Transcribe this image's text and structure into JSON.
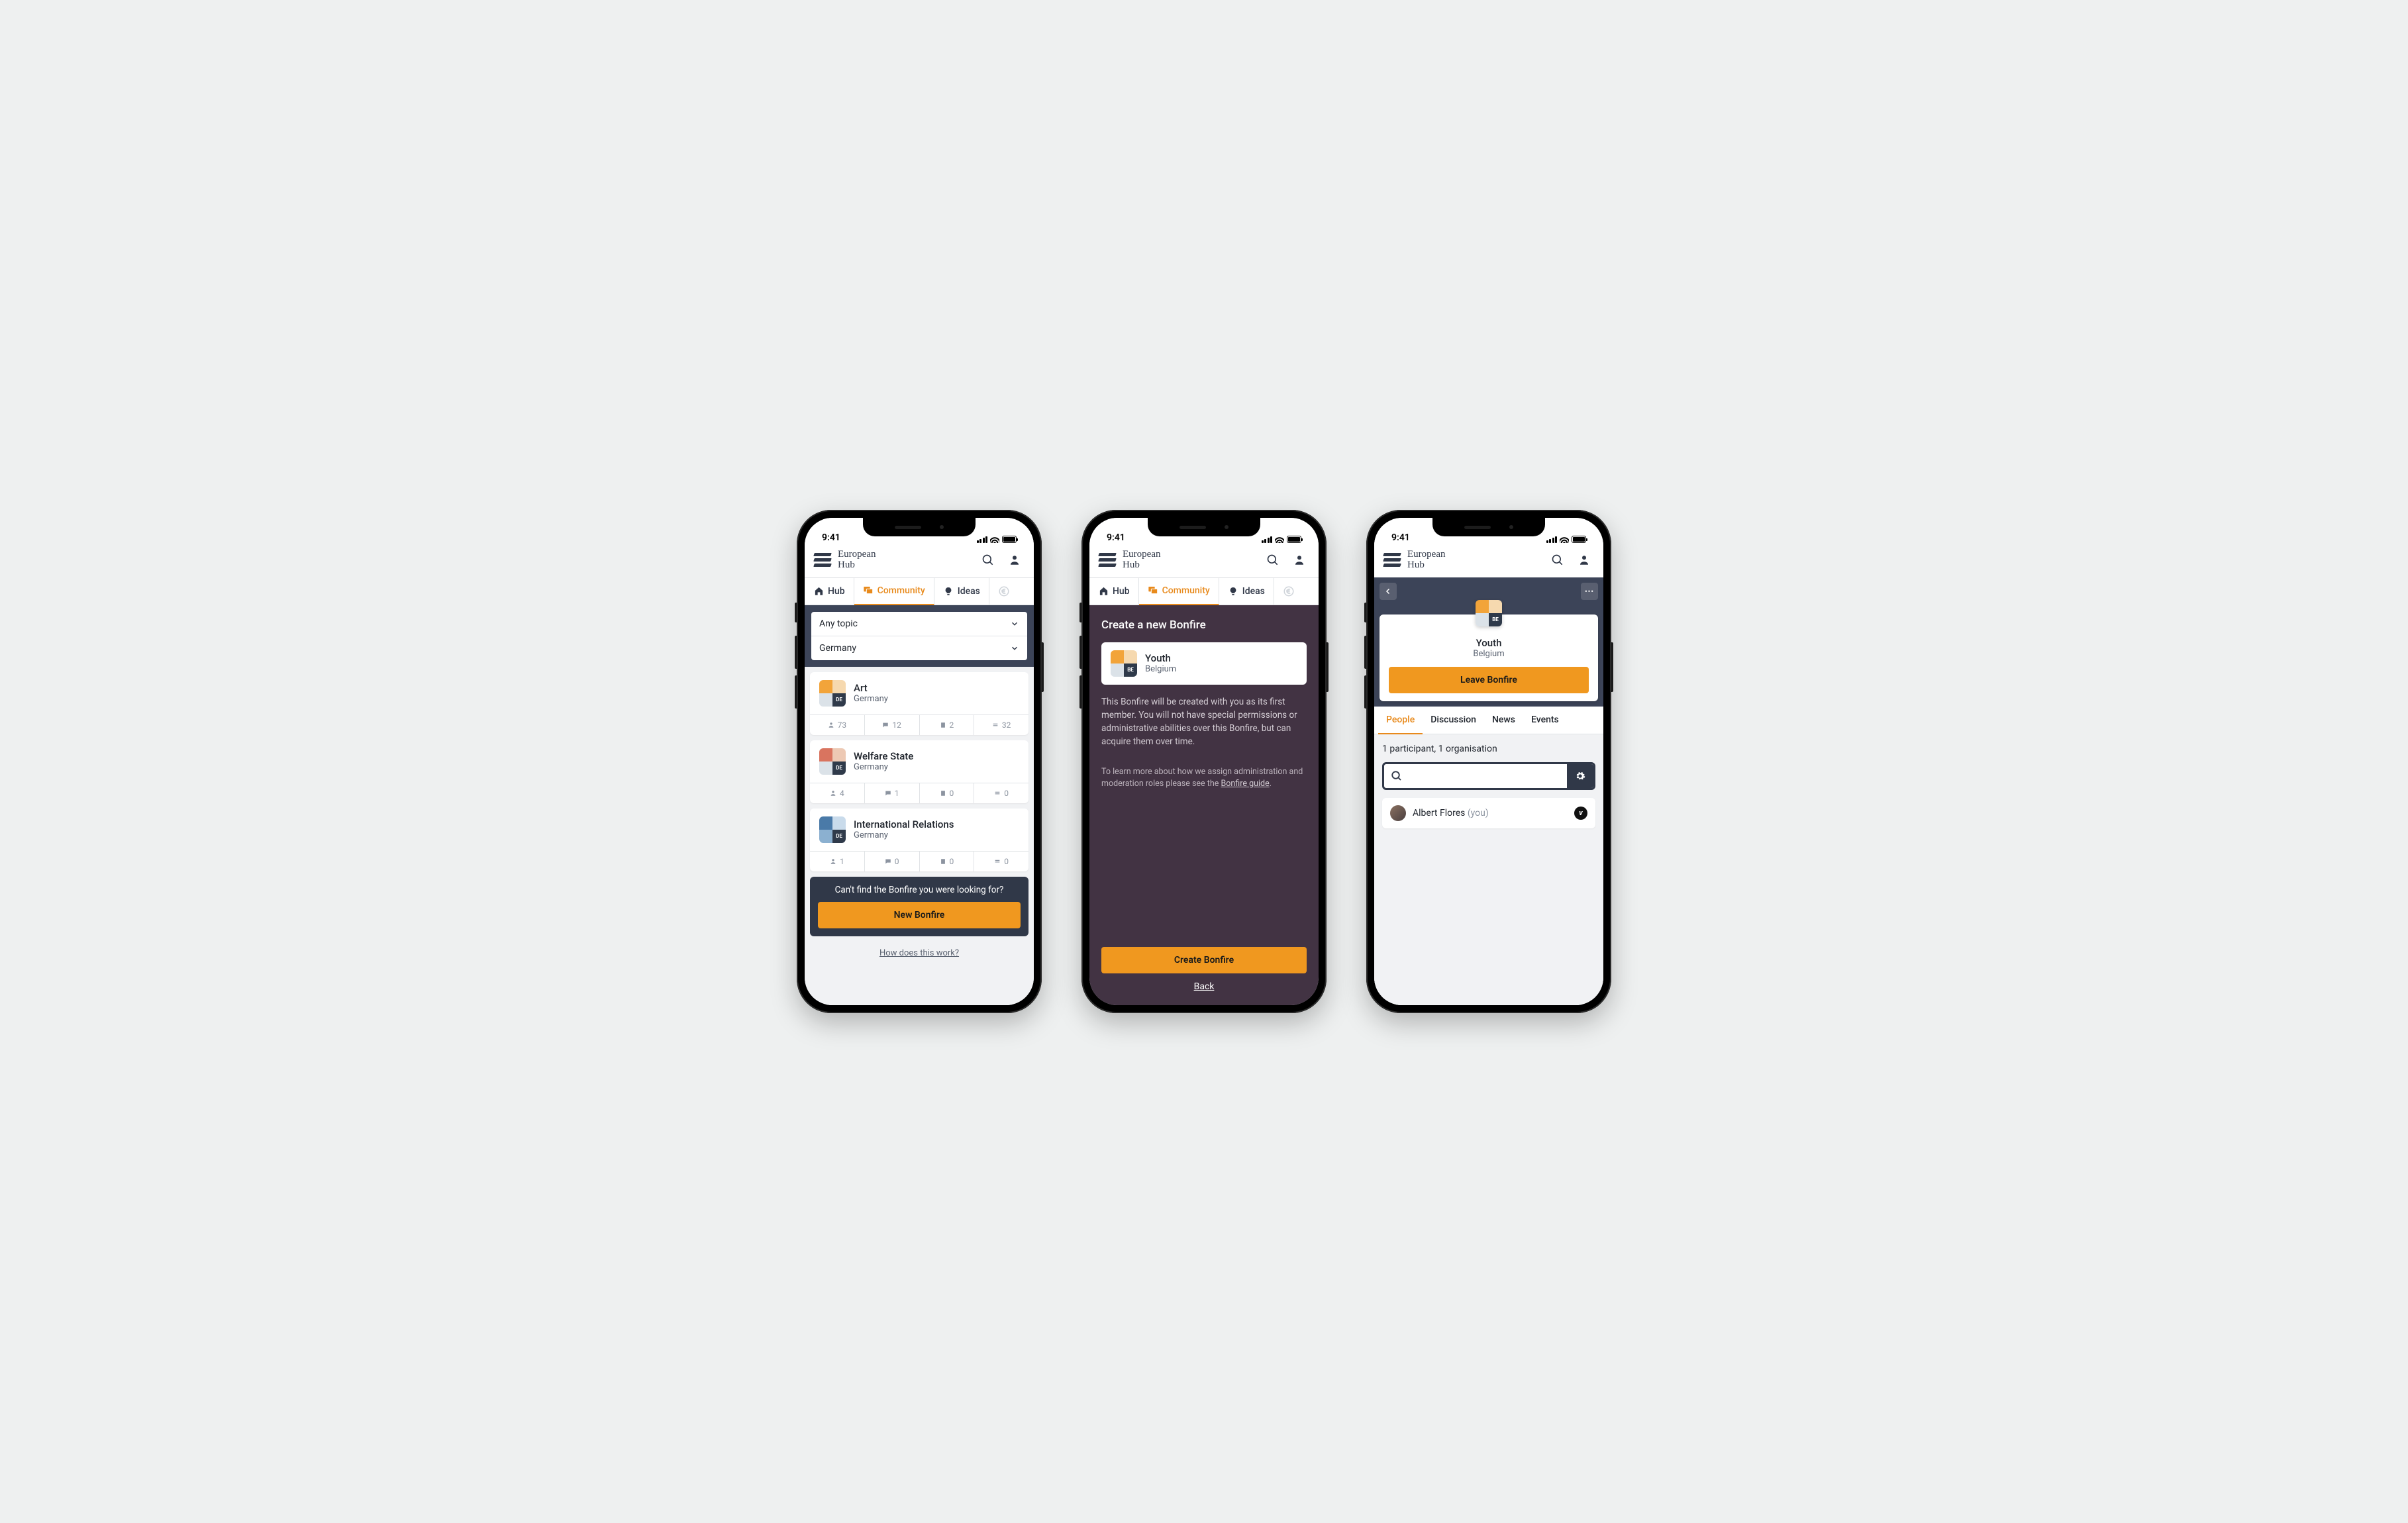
{
  "status": {
    "time": "9:41"
  },
  "brand": {
    "line1": "European",
    "line2": "Hub"
  },
  "nav": {
    "hub": "Hub",
    "community": "Community",
    "ideas": "Ideas"
  },
  "screen1": {
    "filters": {
      "topic": "Any topic",
      "country": "Germany"
    },
    "cards": [
      {
        "title": "Art",
        "sub": "Germany",
        "code": "DE",
        "style": "orange",
        "stats": {
          "members": "73",
          "posts": "12",
          "docs": "2",
          "views": "32"
        }
      },
      {
        "title": "Welfare State",
        "sub": "Germany",
        "code": "DE",
        "style": "red",
        "stats": {
          "members": "4",
          "posts": "1",
          "docs": "0",
          "views": "0"
        }
      },
      {
        "title": "International Relations",
        "sub": "Germany",
        "code": "DE",
        "style": "blue",
        "stats": {
          "members": "1",
          "posts": "0",
          "docs": "0",
          "views": "0"
        }
      }
    ],
    "cta": {
      "question": "Can't find the Bonfire you were looking for?",
      "button": "New Bonfire"
    },
    "footer": "How does this work?"
  },
  "screen2": {
    "heading": "Create a new Bonfire",
    "card": {
      "title": "Youth",
      "sub": "Belgium",
      "code": "BE"
    },
    "desc1": "This Bonfire will be created with you as its first member. You will not have special permissions or administrative abilities over this Bonfire, but can acquire them over time.",
    "desc2_pre": "To learn more about how we assign administration and moderation roles please see the ",
    "desc2_link": "Bonfire guide",
    "desc2_post": ".",
    "button": "Create Bonfire",
    "back": "Back"
  },
  "screen3": {
    "hero": {
      "title": "Youth",
      "sub": "Belgium",
      "code": "BE",
      "button": "Leave Bonfire"
    },
    "tabs": {
      "people": "People",
      "discussion": "Discussion",
      "news": "News",
      "events": "Events"
    },
    "summary": "1 participant, 1 organisation",
    "person": {
      "name": "Albert Flores",
      "suffix": "(you)"
    }
  }
}
